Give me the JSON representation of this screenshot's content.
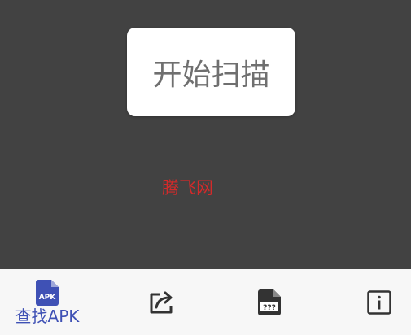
{
  "main": {
    "scan_button_label": "开始扫描",
    "watermark_text": "腾飞网"
  },
  "bottom_nav": {
    "items": [
      {
        "label": "查找APK",
        "icon": "apk-file-icon",
        "active": true
      },
      {
        "label": "",
        "icon": "share-icon",
        "active": false
      },
      {
        "label": "",
        "icon": "unknown-file-icon",
        "active": false
      },
      {
        "label": "",
        "icon": "info-icon",
        "active": false
      }
    ],
    "apk_icon_text": "APK",
    "unknown_icon_text": "???"
  },
  "colors": {
    "background": "#424242",
    "nav_background": "#f7f7f7",
    "accent": "#3f51b5",
    "icon_dark": "#333333",
    "watermark": "#d42a2a",
    "button_text": "#6f6f6f"
  }
}
